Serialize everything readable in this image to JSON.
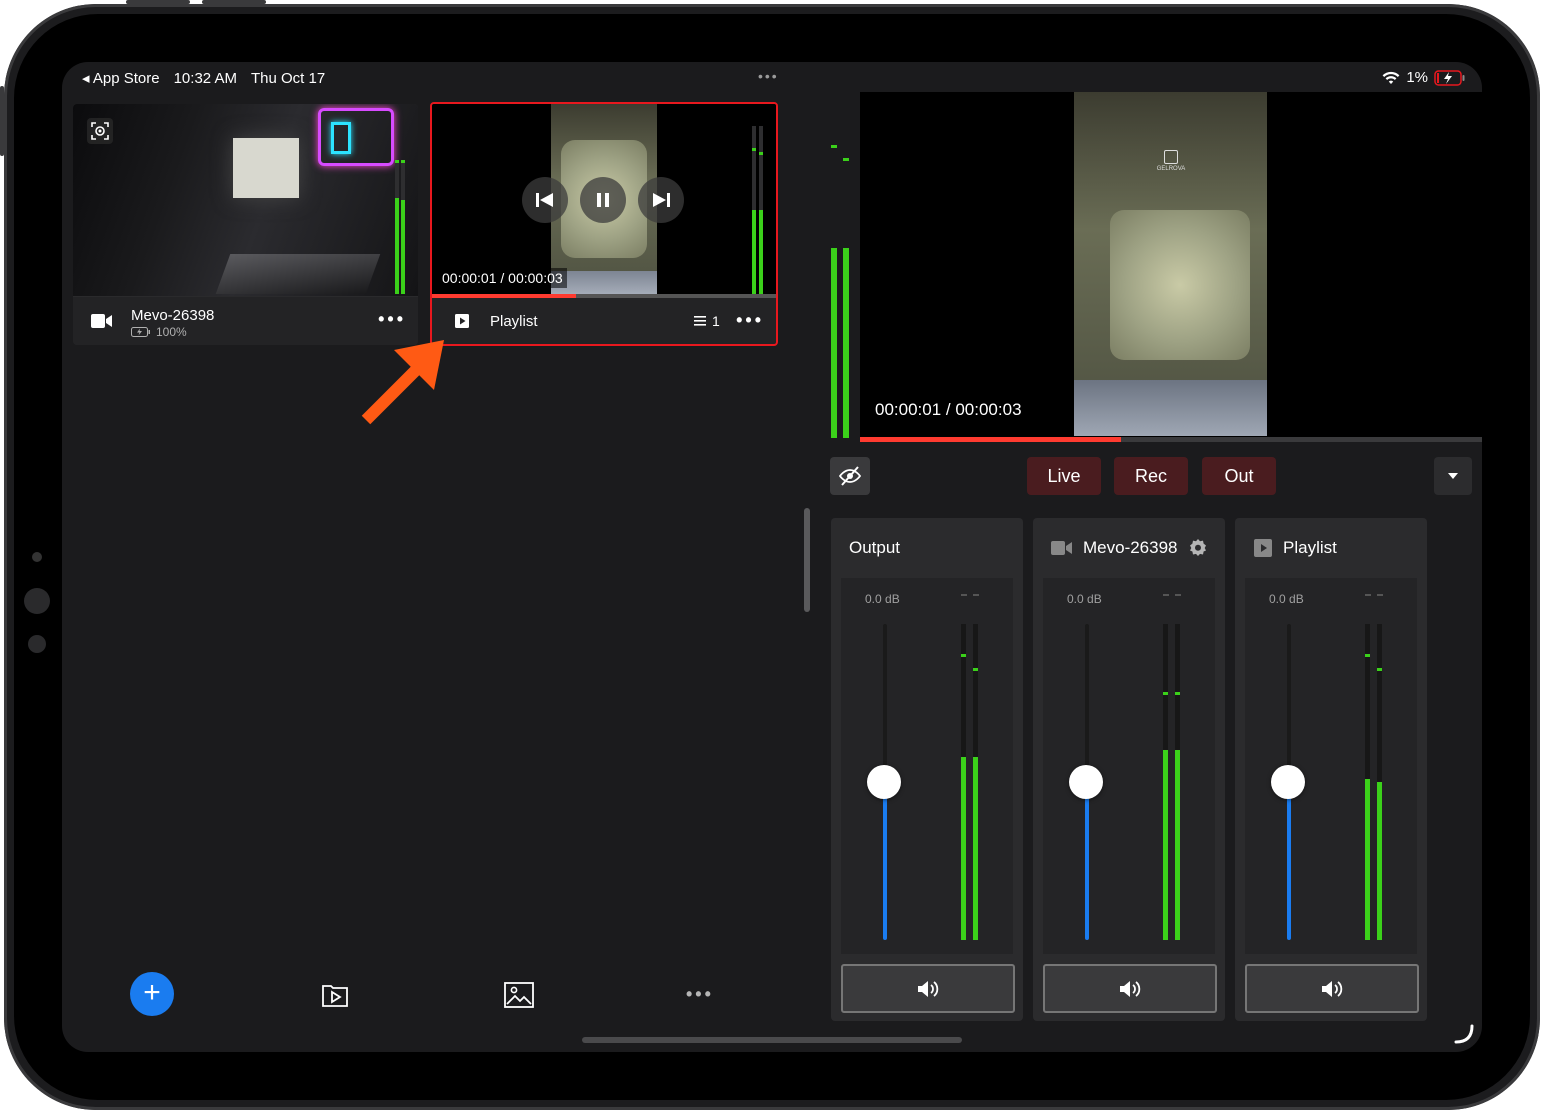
{
  "status_bar": {
    "back_app": "App Store",
    "time": "10:32 AM",
    "date": "Thu Oct 17",
    "battery": "1%",
    "multitask_dots": "•••"
  },
  "sources": [
    {
      "name": "Mevo-26398",
      "battery": "100%",
      "more": "•••",
      "icon": "video-camera-icon"
    },
    {
      "name": "Playlist",
      "timecode": "00:00:01 / 00:00:03",
      "queue_count": "1",
      "more": "•••",
      "icon": "playlist-icon",
      "progress": 0.42,
      "selected": true,
      "highlight_color": "#e8181e"
    }
  ],
  "program": {
    "timecode": "00:00:01 / 00:00:03",
    "progress": 0.42
  },
  "modes": {
    "live": "Live",
    "rec": "Rec",
    "out": "Out"
  },
  "mixer": [
    {
      "title": "Output",
      "db": "0.0 dB",
      "icon": "",
      "settings": false,
      "fader_level": 0.5
    },
    {
      "title": "Mevo-26398",
      "db": "0.0 dB",
      "icon": "video-camera-icon",
      "settings": true,
      "fader_level": 0.5
    },
    {
      "title": "Playlist",
      "db": "0.0 dB",
      "icon": "playlist-icon",
      "settings": false,
      "fader_level": 0.5
    }
  ],
  "bottom_bar": {
    "add": "+",
    "more": "•••"
  },
  "colors": {
    "accent_blue": "#1a7cf0",
    "meter_green": "#3bd11a",
    "progress_red": "#ff3b30",
    "annotation_orange": "#ff5a14"
  }
}
